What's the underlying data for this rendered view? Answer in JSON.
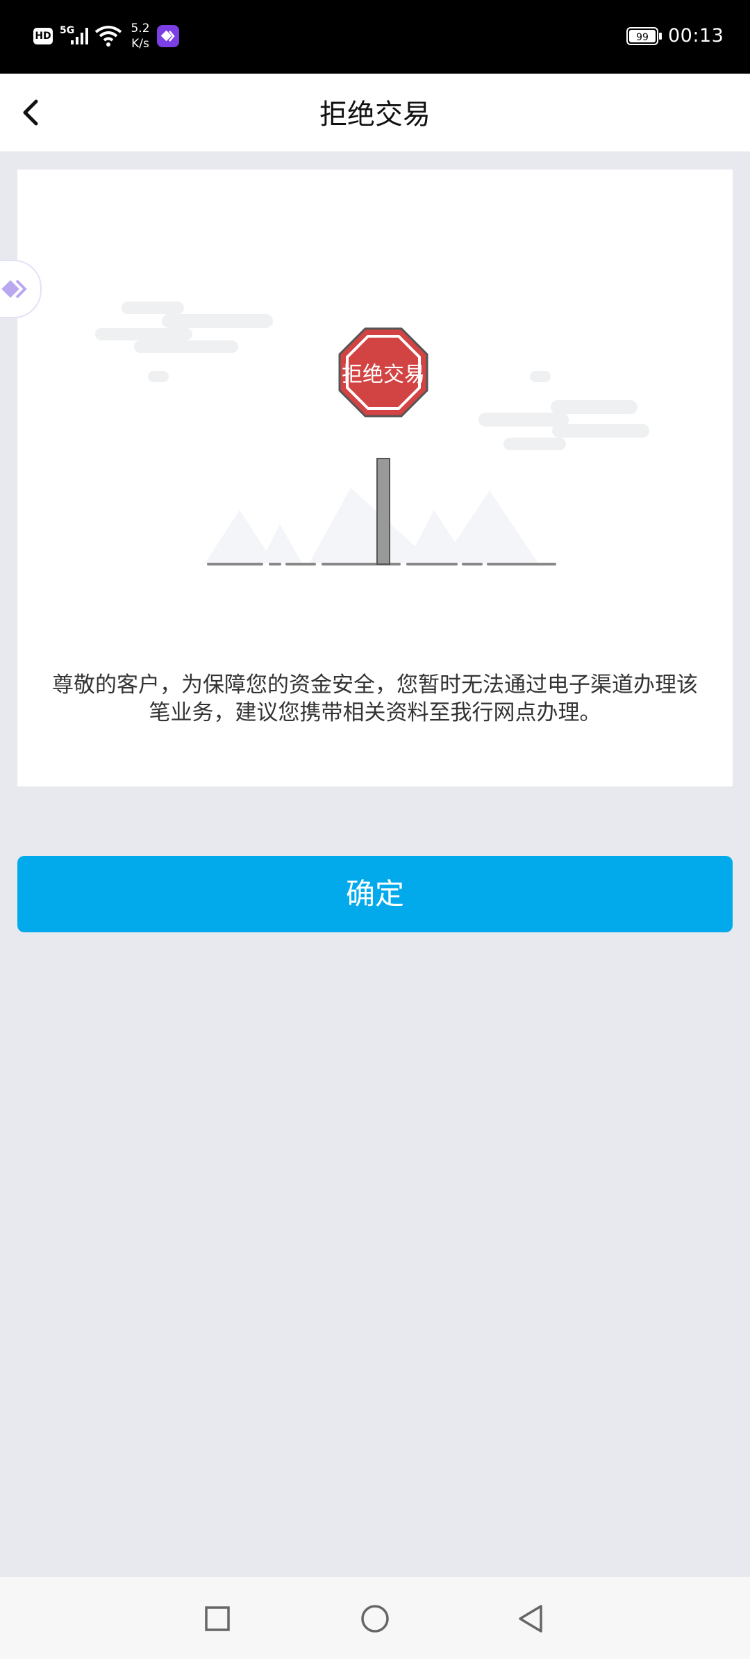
{
  "status_bar": {
    "hd_label": "HD",
    "network_label": "5G",
    "speed_value": "5.2",
    "speed_unit": "K/s",
    "battery_level": "99",
    "time": "00:13",
    "icons": [
      "hd-icon",
      "signal-icon",
      "wifi-icon",
      "app-icon",
      "battery-icon"
    ]
  },
  "header": {
    "title": "拒绝交易",
    "back_icon": "chevron-left-icon"
  },
  "card": {
    "sign_text": "拒绝交易",
    "message": "尊敬的客户，为保障您的资金安全，您暂时无法通过电子渠道办理该笔业务，建议您携带相关资料至我行网点办理。"
  },
  "confirm_button": {
    "label": "确定"
  },
  "nav_bar": {
    "icons": [
      "recent-apps-icon",
      "home-icon",
      "back-icon"
    ]
  },
  "colors": {
    "accent": "#03aaeb",
    "sign_red": "#d24343",
    "background": "#e8e9ee"
  }
}
